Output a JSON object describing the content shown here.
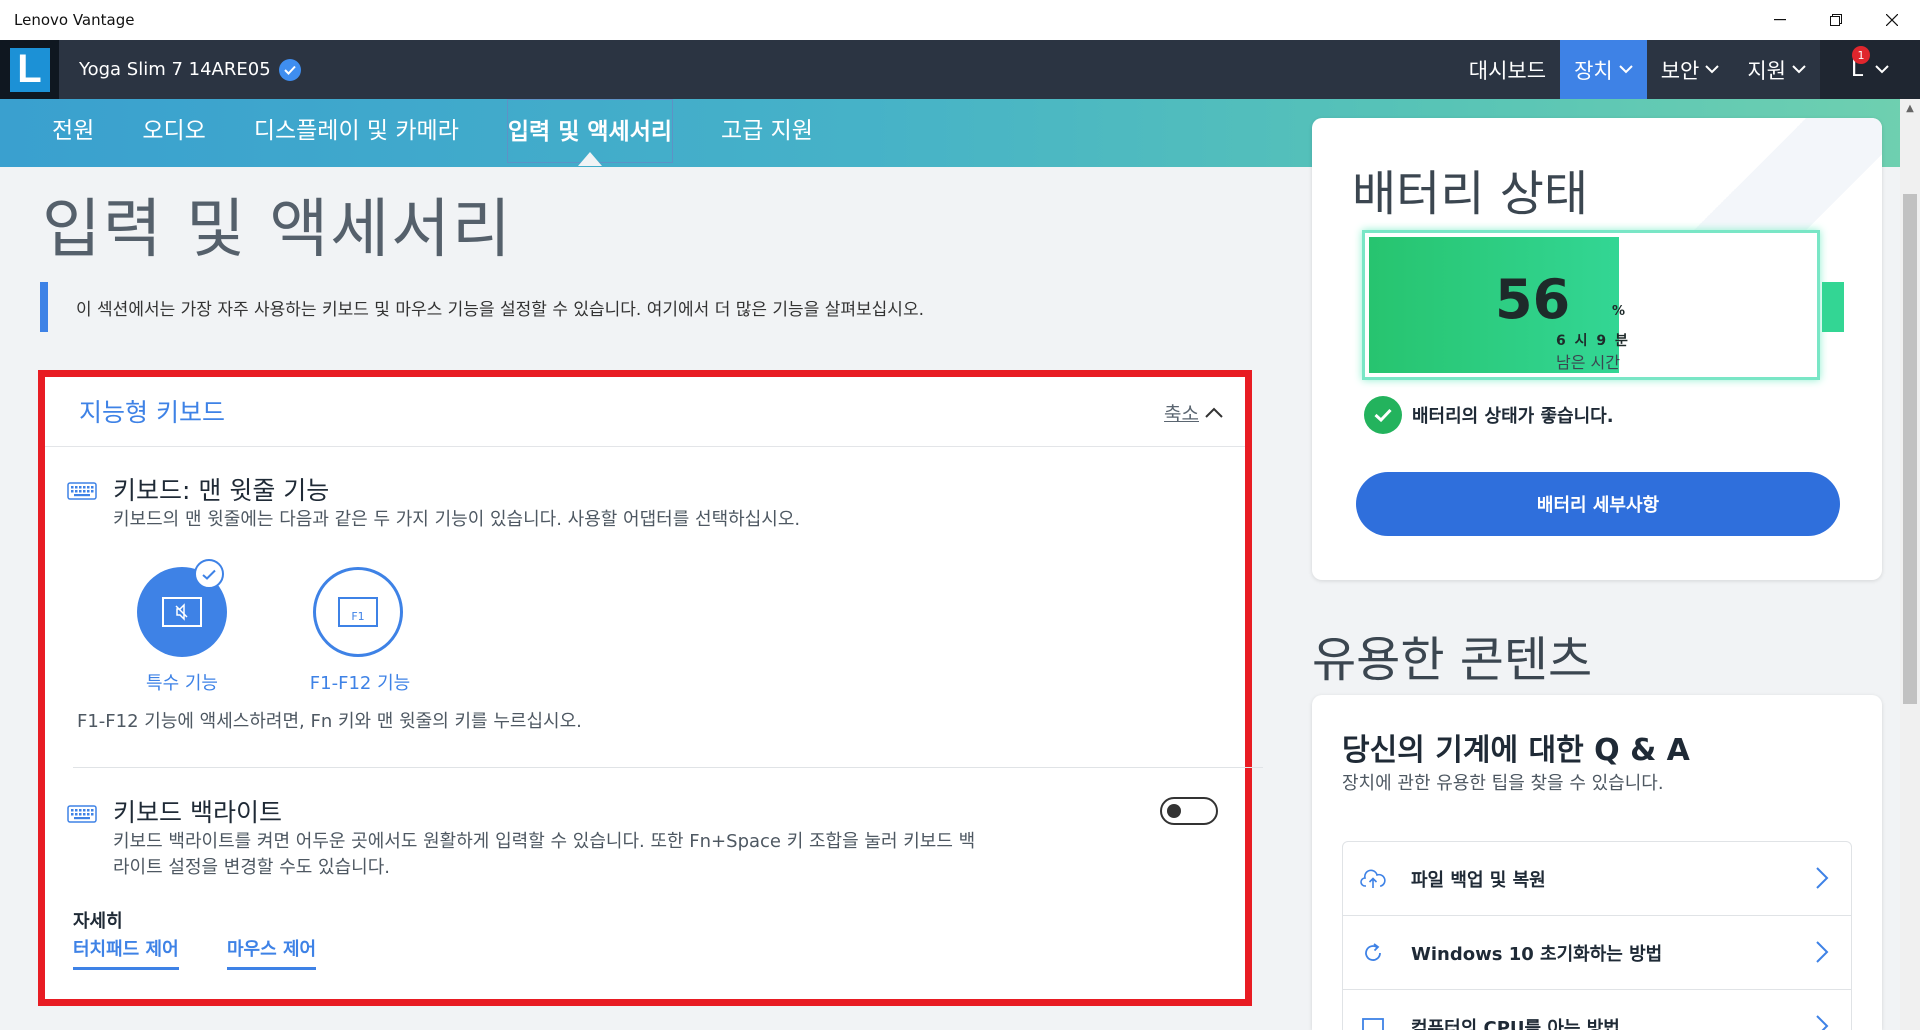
{
  "window": {
    "title": "Lenovo Vantage",
    "controls": [
      "minimize-icon",
      "restore-icon",
      "close-icon"
    ]
  },
  "header": {
    "logo_letter": "L",
    "device_name": "Yoga Slim 7 14ARE05",
    "nav": [
      {
        "label": "대시보드",
        "active": false
      },
      {
        "label": "장치",
        "active": true
      },
      {
        "label": "보안",
        "active": false
      },
      {
        "label": "지원",
        "active": false
      }
    ],
    "user_initial": "L",
    "notification_count": "1"
  },
  "tabs": [
    "전원",
    "오디오",
    "디스플레이 및 카메라",
    "입력 및 액세서리",
    "고급 지원"
  ],
  "active_tab": "입력 및 액세서리",
  "page": {
    "title": "입력 및 액세서리",
    "intro": "이 섹션에서는 가장 자주 사용하는 키보드 및 마우스 기능을 설정할 수 있습니다. 여기에서 더 많은 기능을 살펴보십시오."
  },
  "section": {
    "title": "지능형 키보드",
    "collapse_label": "축소",
    "top_row": {
      "title": "키보드: 맨 윗줄 기능",
      "desc": "키보드의 맨 윗줄에는 다음과 같은 두 가지 기능이 있습니다. 사용할 어댑터를 선택하십시오.",
      "options": [
        {
          "label": "특수 기능",
          "selected": true
        },
        {
          "label": "F1-F12 기능",
          "selected": false,
          "key_label": "F1"
        }
      ],
      "note": "F1-F12 기능에 액세스하려면, Fn 키와 맨 윗줄의 키를 누르십시오."
    },
    "backlight": {
      "title": "키보드 백라이트",
      "desc_line1": "키보드 백라이트를 켜면 어두운 곳에서도 원활하게 입력할 수 있습니다. 또한 Fn+Space 키 조합을 눌러 키보드 백",
      "desc_line2": "라이트 설정을 변경할 수도 있습니다.",
      "enabled": false
    },
    "more": {
      "label": "자세히",
      "links": [
        "터치패드 제어",
        "마우스 제어"
      ]
    }
  },
  "battery": {
    "title": "배터리 상태",
    "percent": "56",
    "percent_sign": "%",
    "percent_value": 56,
    "time_left": "6 시 9 분",
    "time_label": "남은 시간",
    "health_text": "배터리의 상태가 좋습니다.",
    "details_button": "배터리 세부사항",
    "colors": {
      "fill": "#33d694",
      "outline": "#79e6c6",
      "ok": "#23b35d"
    }
  },
  "useful": {
    "title": "유용한 콘텐츠",
    "qa_title": "당신의 기계에 대한 Q & A",
    "qa_sub": "장치에 관한 유용한 팁을 찾을 수 있습니다.",
    "items": [
      {
        "label": "파일 백업 및 복원",
        "icon": "cloud-upload-icon"
      },
      {
        "label": "Windows 10 초기화하는 방법",
        "icon": "refresh-icon"
      },
      {
        "label": "컴퓨터의 CPU를 아는 방법",
        "icon": "monitor-icon"
      }
    ]
  },
  "accent_color": "#3e82e6",
  "highlight_color": "#e81c23"
}
